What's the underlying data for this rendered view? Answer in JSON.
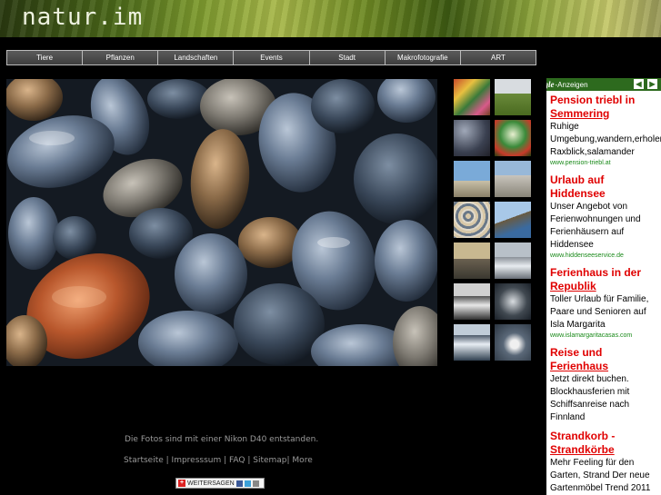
{
  "header": {
    "logo": "natur.im"
  },
  "nav": {
    "items": [
      "Tiere",
      "Pflanzen",
      "Landschaften",
      "Events",
      "Stadt",
      "Makrofotografie",
      "ART"
    ]
  },
  "ads": {
    "brand": "Google",
    "label": "-Anzeigen",
    "items": [
      {
        "title_lines": [
          "Pension triebl in",
          "Semmering"
        ],
        "title_underline": [
          false,
          true
        ],
        "body": [
          "Ruhige",
          "Umgebung,wandern,erholen",
          "Raxblick,salamander"
        ],
        "url": "www.pension-triebl.at"
      },
      {
        "title_lines": [
          "Urlaub auf Hiddensee"
        ],
        "title_underline": [
          false
        ],
        "body": [
          "Unser Angebot von",
          "Ferienwohnungen und",
          "Ferienhäusern auf",
          "Hiddensee"
        ],
        "url": "www.hiddenseeservice.de"
      },
      {
        "title_lines": [
          "Ferienhaus in der",
          "Republik"
        ],
        "title_underline": [
          false,
          true
        ],
        "body": [
          "Toller Urlaub für Familie,",
          "Paare und Senioren auf",
          "Isla Margarita"
        ],
        "url": "www.islamargaritacasas.com"
      },
      {
        "title_lines": [
          "Reise und",
          "Ferienhaus"
        ],
        "title_underline": [
          false,
          true
        ],
        "body": [
          "Jetzt direkt buchen.",
          "Blockhausferien mit",
          "Schiffsanreise nach",
          "Finnland"
        ],
        "url": ""
      },
      {
        "title_lines": [
          "Strandkorb -",
          "Strandkörbe"
        ],
        "title_underline": [
          false,
          true
        ],
        "body": [
          "Mehr Feeling für den",
          "Garten, Strand Der neue",
          "Gartenmöbel Trend 2011"
        ],
        "url": ""
      }
    ]
  },
  "footer": {
    "note": "Die Fotos sind mit einer Nikon D40 entstanden.",
    "links": [
      "Startseite",
      "Impresssum",
      "FAQ",
      "Sitemap",
      "More"
    ],
    "share_label": "WEITERSAGEN"
  },
  "thumbnails": [
    "colorful-pebbles",
    "green-field",
    "wet-pebbles",
    "green-flowers",
    "beach-sky",
    "beach-wall",
    "pebble-pile",
    "cliff-sea",
    "shore-sunset",
    "waves-gray",
    "surf-bw",
    "rocks-water",
    "rough-sea",
    "bird-water"
  ],
  "colors": {
    "ad_title": "#e00000",
    "ad_url": "#1a8a1a",
    "ads_header": "#2d6a1e",
    "footer_text": "#9a9a9a"
  }
}
